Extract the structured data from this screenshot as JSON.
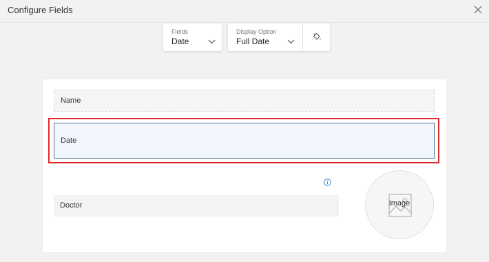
{
  "header": {
    "title": "Configure Fields"
  },
  "toolbar": {
    "fields": {
      "label": "Fields",
      "value": "Date"
    },
    "display": {
      "label": "Display Option",
      "value": "Full Date"
    }
  },
  "canvas": {
    "fields": [
      {
        "label": "Name"
      },
      {
        "label": "Date"
      },
      {
        "label": "Doctor"
      }
    ],
    "image_label": "Image"
  },
  "colors": {
    "selection": "#e12a2a",
    "selected_field_border": "#4a6f8f",
    "info": "#3a8fd6"
  }
}
